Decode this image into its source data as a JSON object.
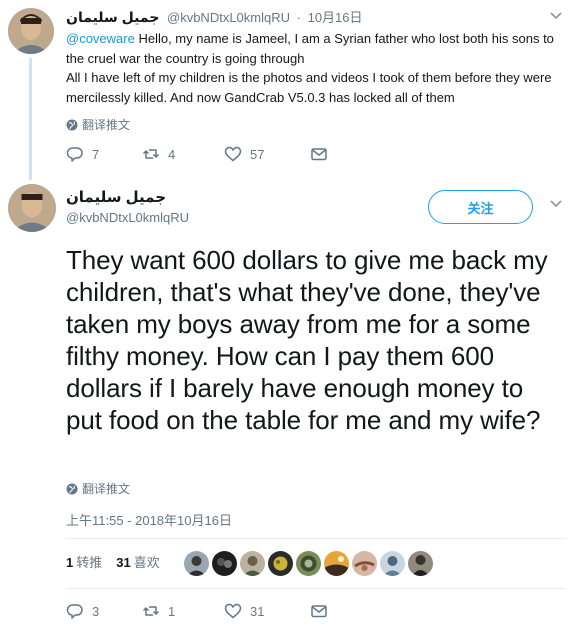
{
  "tweet1": {
    "name": "جميل سليمان",
    "handle": "@kvbNDtxL0kmlqRU",
    "date": "10月16日",
    "mention": "@coveware",
    "text_line1": " Hello, my name is Jameel, I am a Syrian father who lost both his sons to the cruel war the country is going through",
    "text_line2": "All I have left of my children is the photos and videos I took of them before they were mercilessly killed. And now GandCrab V5.0.3 has locked all of them",
    "translate": "翻译推文",
    "reply_count": "7",
    "retweet_count": "4",
    "like_count": "57"
  },
  "tweet2": {
    "name": "جميل سليمان",
    "handle": "@kvbNDtxL0kmlqRU",
    "follow_label": "关注",
    "text": "They want 600 dollars to give me back my children, that's what they've done, they've taken my boys away from me for a some filthy money. How can I pay them 600 dollars if I barely have enough money to put food on the table for me and my wife?",
    "translate": "翻译推文",
    "timestamp": "上午11:55 - 2018年10月16日",
    "retweet_stat_num": "1",
    "retweet_stat_label": "转推",
    "like_stat_num": "31",
    "like_stat_label": "喜欢",
    "reply_count": "3",
    "retweet_count": "1",
    "like_count": "31"
  },
  "icons": {
    "reply": "reply-icon",
    "retweet": "retweet-icon",
    "like": "heart-icon",
    "message": "envelope-icon",
    "globe": "globe-icon",
    "chevron": "chevron-down-icon"
  },
  "colors": {
    "accent": "#1da1f2",
    "link": "#1b95e0",
    "muted": "#657786",
    "thread_line": "#cfe3f2"
  }
}
